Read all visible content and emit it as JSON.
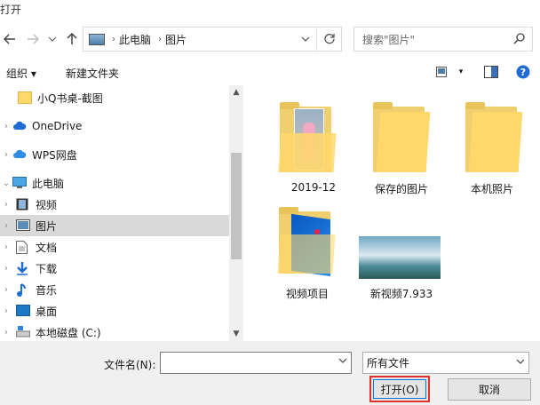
{
  "window": {
    "title": "打开"
  },
  "nav": {
    "back_icon": "back-arrow-icon",
    "forward_icon": "forward-arrow-icon",
    "dropdown_icon": "chevron-down-icon",
    "up_icon": "up-arrow-icon",
    "address": {
      "segments": [
        "此电脑",
        "图片"
      ]
    },
    "refresh_icon": "refresh-icon",
    "search": {
      "placeholder": "搜索\"图片\""
    }
  },
  "toolbar": {
    "organize_label": "组织 ▾",
    "new_folder_label": "新建文件夹"
  },
  "tree": {
    "items": [
      {
        "label": "小Q书桌-截图",
        "icon": "folder-icon"
      },
      {
        "label": "OneDrive",
        "icon": "cloud-icon"
      },
      {
        "label": "WPS网盘",
        "icon": "cloud-icon"
      },
      {
        "label": "此电脑",
        "icon": "computer-icon"
      },
      {
        "label": "视频",
        "icon": "video-icon"
      },
      {
        "label": "图片",
        "icon": "pictures-icon"
      },
      {
        "label": "文档",
        "icon": "document-icon"
      },
      {
        "label": "下载",
        "icon": "download-icon"
      },
      {
        "label": "音乐",
        "icon": "music-icon"
      },
      {
        "label": "桌面",
        "icon": "desktop-icon"
      },
      {
        "label": "本地磁盘 (C:)",
        "icon": "drive-icon"
      }
    ]
  },
  "files": [
    {
      "label": "2019-12",
      "type": "folder-with-photo"
    },
    {
      "label": "保存的图片",
      "type": "folder"
    },
    {
      "label": "本机照片",
      "type": "folder"
    },
    {
      "label": "视频项目",
      "type": "folder-with-blue"
    },
    {
      "label": "新视频7.933",
      "type": "image"
    }
  ],
  "bottom": {
    "filename_label": "文件名(N):",
    "filename_value": "",
    "filter_value": "所有文件",
    "open_label": "打开(O)",
    "cancel_label": "取消"
  },
  "colors": {
    "selected_bg": "#d9d9d9",
    "folder": "#ffd86b",
    "highlight_border": "#e0322b",
    "accent": "#0078d7"
  }
}
